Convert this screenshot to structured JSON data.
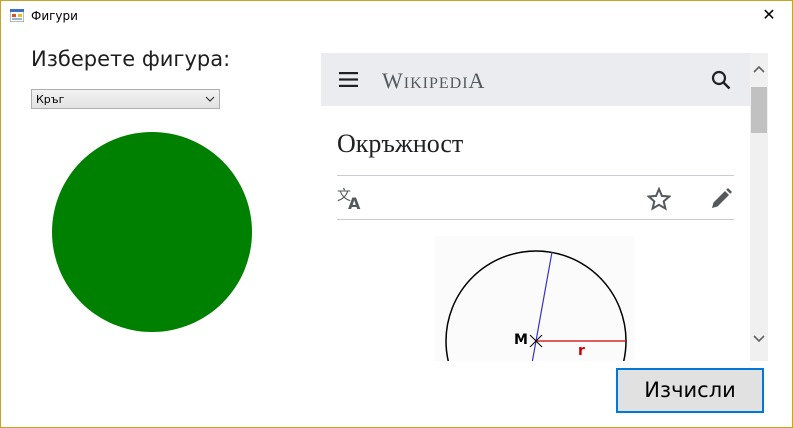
{
  "window": {
    "title": "Фигури",
    "icon": "winforms-app-icon",
    "close_symbol": "✕"
  },
  "form": {
    "prompt_label": "Изберете фигура:",
    "shape_select": {
      "selected": "Кръг",
      "icon": "chevron-down-icon"
    },
    "shape_preview": {
      "shape": "circle",
      "fill_color": "#008000"
    },
    "calculate_button": "Изчисли"
  },
  "browser": {
    "header": {
      "menu_icon": "hamburger-menu-icon",
      "logo_first_letter": "W",
      "logo_middle": "IKIPEDI",
      "logo_last_letter": "A",
      "search_icon": "search-icon"
    },
    "article_title": "Окръжност",
    "toolbar": {
      "language_icon": "translate-icon",
      "watch_icon": "star-icon",
      "edit_icon": "pencil-icon"
    },
    "figure": {
      "center_label": "M",
      "radius_label": "r",
      "circle_color": "#000000",
      "diameter_color": "#3333cc",
      "radius_color": "#cc0000"
    },
    "scrollbar": {
      "up_icon": "scroll-up-arrow-icon",
      "down_icon": "scroll-down-arrow-icon"
    }
  }
}
